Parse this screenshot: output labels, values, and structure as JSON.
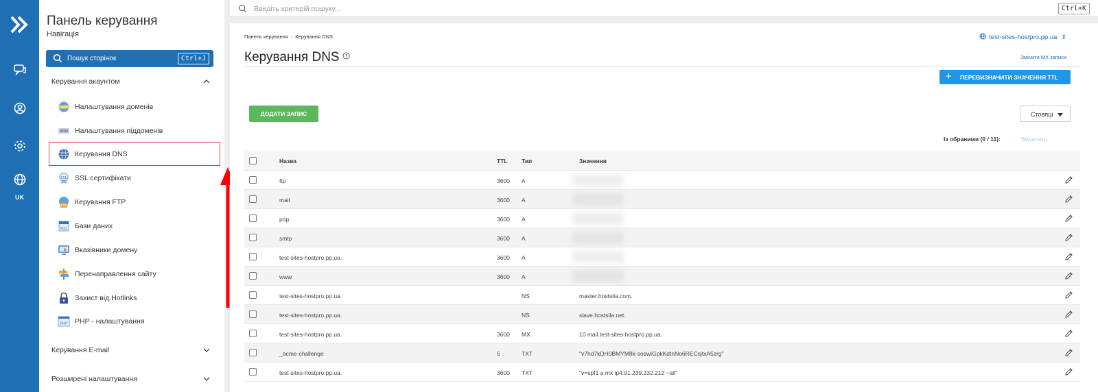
{
  "rail": {
    "lang": "UK"
  },
  "sidebar": {
    "title": "Панель керування",
    "subtitle": "Навігація",
    "search_label": "Пошук сторінок",
    "search_shortcut": "Ctrl+J",
    "group_account": "Керування акаунтом",
    "items": [
      {
        "label": "Налаштування доменів",
        "icon": "domains-icon"
      },
      {
        "label": "Налаштування піддоменів",
        "icon": "subdomains-icon"
      },
      {
        "label": "Керування DNS",
        "icon": "dns-icon"
      },
      {
        "label": "SSL сертифікати",
        "icon": "ssl-icon"
      },
      {
        "label": "Керування FTP",
        "icon": "ftp-icon"
      },
      {
        "label": "Бази даних",
        "icon": "database-icon"
      },
      {
        "label": "Вказівники домену",
        "icon": "domain-pointer-icon"
      },
      {
        "label": "Перенаправлення сайту",
        "icon": "redirect-icon"
      },
      {
        "label": "Захист від Hotlinks",
        "icon": "lock-icon"
      },
      {
        "label": "PHP - налаштування",
        "icon": "php-icon"
      }
    ],
    "group_email": "Керування E-mail",
    "group_advanced": "Розширені налаштування"
  },
  "topbar": {
    "search_placeholder": "Введіть критерій пошуку...",
    "shortcut": "Ctrl+K"
  },
  "breadcrumb": {
    "home": "Панель керування",
    "current": "Керування DNS"
  },
  "domain_selector": "test-sites-hostpro.pp.ua",
  "page_title": "Керування DNS",
  "mx_link": "Змінити MX записи",
  "ttl_button": "ПЕРЕВИЗНАЧИТИ ЗНАЧЕННЯ TTL",
  "add_button": "ДОДАТИ ЗАПИС",
  "columns_button": "Стовпці",
  "selected_label": "Із обраними (0 / 11):",
  "delete_label": "Видалити",
  "table": {
    "headers": {
      "name": "Назва",
      "ttl": "TTL",
      "type": "Тип",
      "value": "Значення"
    },
    "rows": [
      {
        "name": "ftp",
        "ttl": "3600",
        "type": "A",
        "value": ""
      },
      {
        "name": "mail",
        "ttl": "3600",
        "type": "A",
        "value": ""
      },
      {
        "name": "pop",
        "ttl": "3600",
        "type": "A",
        "value": ""
      },
      {
        "name": "smtp",
        "ttl": "3600",
        "type": "A",
        "value": ""
      },
      {
        "name": "test-sites-hostpro.pp.ua.",
        "ttl": "3600",
        "type": "A",
        "value": ""
      },
      {
        "name": "www",
        "ttl": "3600",
        "type": "A",
        "value": ""
      },
      {
        "name": "test-sites-hostpro.pp.ua.",
        "ttl": "",
        "type": "NS",
        "value": "master.hostsila.com."
      },
      {
        "name": "test-sites-hostpro.pp.ua.",
        "ttl": "",
        "type": "NS",
        "value": "slave.hostsila.net."
      },
      {
        "name": "test-sites-hostpro.pp.ua.",
        "ttl": "3600",
        "type": "MX",
        "value": "10 mail.test-sites-hostpro.pp.ua."
      },
      {
        "name": "_acme-challenge",
        "ttl": "5",
        "type": "TXT",
        "value": "\"v7hd7kDH0BMYM8k-soswiGpkKdtnNo6RECsjtxA5zrg\""
      },
      {
        "name": "test-sites-hostpro.pp.ua.",
        "ttl": "3600",
        "type": "TXT",
        "value": "\"v=spf1 a mx ip4:91.239.232.212 ~all\""
      }
    ]
  },
  "colors": {
    "brand_blue": "#1f6fb5",
    "button_blue": "#2196e6",
    "add_green": "#5cb85c",
    "highlight_red": "#e43b3b"
  }
}
